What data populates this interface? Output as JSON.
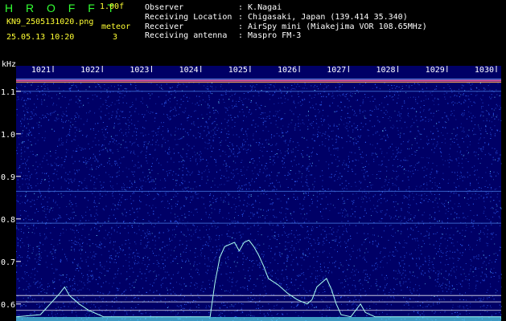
{
  "header": {
    "brand": "H R O F F T",
    "version": "1.00f",
    "filename": "KN9_2505131020.png",
    "meteor_label": "meteor",
    "meteor_count": "3",
    "timestamp": "25.05.13 10:20",
    "info": [
      {
        "key": "Observer",
        "value": ": K.Nagai"
      },
      {
        "key": "Receiving Location",
        "value": ": Chigasaki, Japan (139.414 35.340)"
      },
      {
        "key": "Receiver",
        "value": ": AirSpy mini (Miakejima VOR 108.65MHz)"
      },
      {
        "key": "Receiving antenna",
        "value": ": Maspro FM-3"
      }
    ]
  },
  "chart_data": {
    "type": "heatmap",
    "title": "",
    "xlabel": "",
    "ylabel": "kHz",
    "x_ticks": [
      "1021",
      "1022",
      "1023",
      "1024",
      "1025",
      "1026",
      "1027",
      "1028",
      "1029",
      "1030"
    ],
    "y_ticks": [
      "1.1",
      "1.0",
      "0.9",
      "0.8",
      "0.7",
      "0.6"
    ],
    "y_range": [
      0.56,
      1.16
    ],
    "carrier_khz": 1.125,
    "horizontal_lines_khz": [
      1.1,
      0.865,
      0.79,
      0.62,
      0.605,
      0.585
    ],
    "spectrum_trace": [
      {
        "x": 0.0,
        "y": 0.57
      },
      {
        "x": 0.05,
        "y": 0.575
      },
      {
        "x": 0.09,
        "y": 0.625
      },
      {
        "x": 0.1,
        "y": 0.64
      },
      {
        "x": 0.11,
        "y": 0.62
      },
      {
        "x": 0.13,
        "y": 0.6
      },
      {
        "x": 0.15,
        "y": 0.585
      },
      {
        "x": 0.18,
        "y": 0.57
      },
      {
        "x": 0.4,
        "y": 0.57
      },
      {
        "x": 0.41,
        "y": 0.65
      },
      {
        "x": 0.42,
        "y": 0.71
      },
      {
        "x": 0.43,
        "y": 0.735
      },
      {
        "x": 0.45,
        "y": 0.745
      },
      {
        "x": 0.46,
        "y": 0.725
      },
      {
        "x": 0.47,
        "y": 0.745
      },
      {
        "x": 0.48,
        "y": 0.75
      },
      {
        "x": 0.49,
        "y": 0.735
      },
      {
        "x": 0.5,
        "y": 0.715
      },
      {
        "x": 0.51,
        "y": 0.69
      },
      {
        "x": 0.52,
        "y": 0.66
      },
      {
        "x": 0.54,
        "y": 0.645
      },
      {
        "x": 0.56,
        "y": 0.625
      },
      {
        "x": 0.58,
        "y": 0.61
      },
      {
        "x": 0.6,
        "y": 0.6
      },
      {
        "x": 0.61,
        "y": 0.61
      },
      {
        "x": 0.62,
        "y": 0.64
      },
      {
        "x": 0.63,
        "y": 0.65
      },
      {
        "x": 0.64,
        "y": 0.66
      },
      {
        "x": 0.65,
        "y": 0.635
      },
      {
        "x": 0.66,
        "y": 0.6
      },
      {
        "x": 0.67,
        "y": 0.575
      },
      {
        "x": 0.69,
        "y": 0.57
      },
      {
        "x": 0.71,
        "y": 0.6
      },
      {
        "x": 0.72,
        "y": 0.58
      },
      {
        "x": 0.74,
        "y": 0.57
      },
      {
        "x": 1.0,
        "y": 0.57
      }
    ],
    "colors": {
      "background": "#000066",
      "noise": "#3366ff",
      "noise_bright": "#66ccff",
      "carrier": "#ff66aa",
      "trace": "#aaffee",
      "grid": "#ffffff",
      "tick_label": "#ffffff"
    }
  }
}
